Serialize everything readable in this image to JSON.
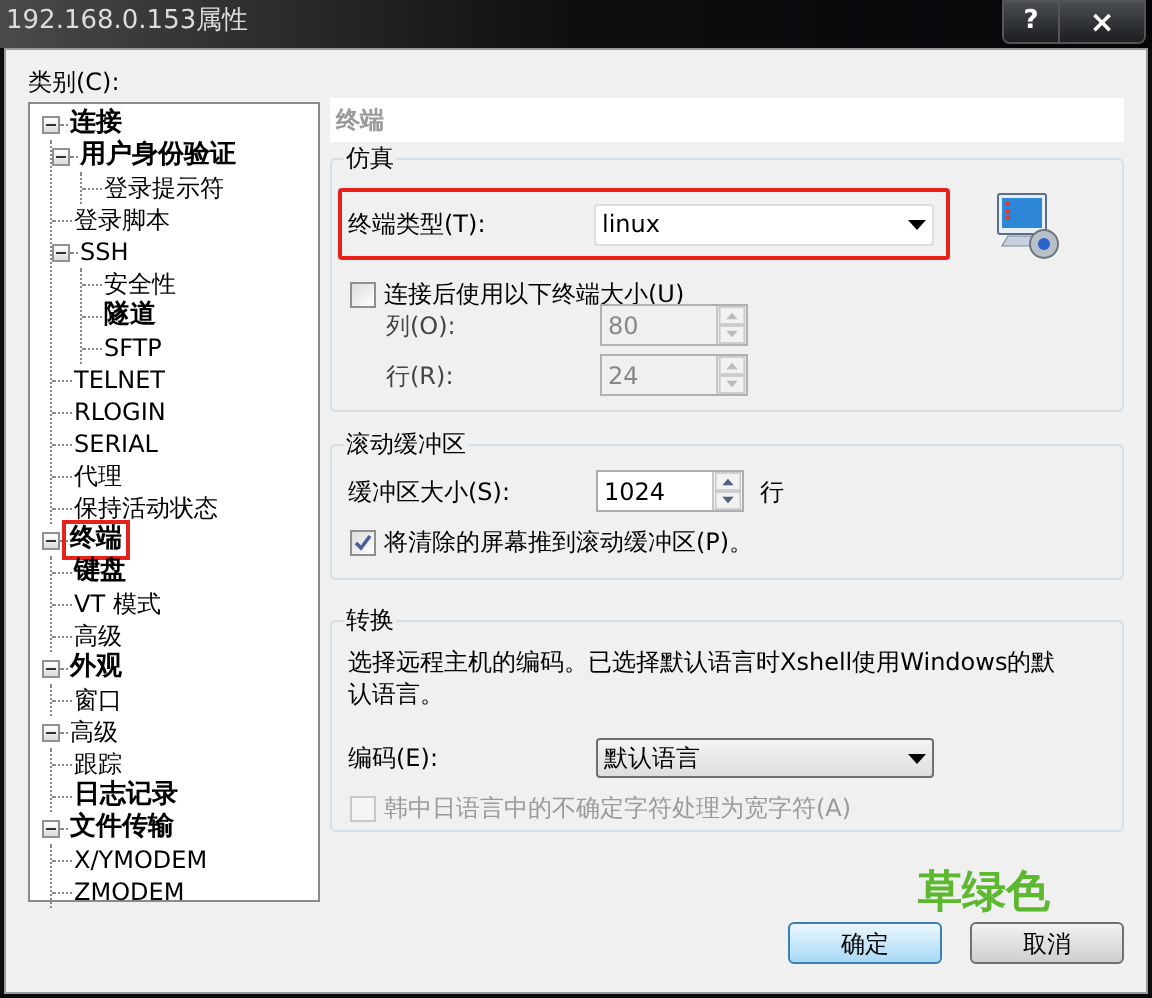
{
  "window": {
    "title": "192.168.0.153属性",
    "controls": [
      {
        "label": "?",
        "kind": "help"
      },
      {
        "label": "×",
        "kind": "close"
      }
    ]
  },
  "category_label": "类别(C):",
  "tree": [
    {
      "label": "连接",
      "bold": true,
      "expanded": true,
      "highlighted": false,
      "children": [
        {
          "label": "用户身份验证",
          "bold": true,
          "expanded": true,
          "highlighted": false,
          "children": [
            {
              "label": "登录提示符",
              "bold": false,
              "highlighted": false
            }
          ]
        },
        {
          "label": "登录脚本",
          "bold": false,
          "highlighted": false
        },
        {
          "label": "SSH",
          "bold": false,
          "expanded": true,
          "highlighted": false,
          "children": [
            {
              "label": "安全性",
              "bold": false,
              "highlighted": false
            },
            {
              "label": "隧道",
              "bold": true,
              "highlighted": false
            },
            {
              "label": "SFTP",
              "bold": false,
              "highlighted": false
            }
          ]
        },
        {
          "label": "TELNET",
          "bold": false,
          "highlighted": false
        },
        {
          "label": "RLOGIN",
          "bold": false,
          "highlighted": false
        },
        {
          "label": "SERIAL",
          "bold": false,
          "highlighted": false
        },
        {
          "label": "代理",
          "bold": false,
          "highlighted": false
        },
        {
          "label": "保持活动状态",
          "bold": false,
          "highlighted": false
        }
      ]
    },
    {
      "label": "终端",
      "bold": true,
      "expanded": true,
      "highlighted": true,
      "children": [
        {
          "label": "键盘",
          "bold": true,
          "highlighted": false
        },
        {
          "label": "VT 模式",
          "bold": false,
          "highlighted": false
        },
        {
          "label": "高级",
          "bold": false,
          "highlighted": false
        }
      ]
    },
    {
      "label": "外观",
      "bold": true,
      "expanded": true,
      "highlighted": false,
      "children": [
        {
          "label": "窗口",
          "bold": false,
          "highlighted": false
        }
      ]
    },
    {
      "label": "高级",
      "bold": false,
      "expanded": true,
      "highlighted": false,
      "children": [
        {
          "label": "跟踪",
          "bold": false,
          "highlighted": false
        },
        {
          "label": "日志记录",
          "bold": true,
          "highlighted": false
        }
      ]
    },
    {
      "label": "文件传输",
      "bold": true,
      "expanded": true,
      "highlighted": false,
      "children": [
        {
          "label": "X/YMODEM",
          "bold": false,
          "highlighted": false
        },
        {
          "label": "ZMODEM",
          "bold": false,
          "highlighted": false
        }
      ]
    }
  ],
  "panel_header": "终端",
  "emulation": {
    "title": "仿真",
    "terminal_type": {
      "label": "终端类型(T):",
      "value": "linux",
      "highlighted": true
    },
    "use_size": {
      "label": "连接后使用以下终端大小(U)",
      "checked": false
    },
    "columns": {
      "label": "列(O):",
      "value": "80",
      "disabled": true
    },
    "rows": {
      "label": "行(R):",
      "value": "24",
      "disabled": true
    }
  },
  "scrollback": {
    "title": "滚动缓冲区",
    "size": {
      "label": "缓冲区大小(S):",
      "value": "1024",
      "unit": "行"
    },
    "push": {
      "label": "将清除的屏幕推到滚动缓冲区(P)。",
      "checked": true
    }
  },
  "translation": {
    "title": "转换",
    "description": "选择远程主机的编码。已选择默认语言时Xshell使用Windows的默认语言。",
    "encoding": {
      "label": "编码(E):",
      "value": "默认语言"
    },
    "cjk": {
      "label": "韩中日语言中的不确定字符处理为宽字符(A)",
      "checked": false,
      "disabled": true
    }
  },
  "buttons": [
    {
      "label": "确定",
      "default": true
    },
    {
      "label": "取消",
      "default": false
    }
  ],
  "annotation": "草绿色"
}
